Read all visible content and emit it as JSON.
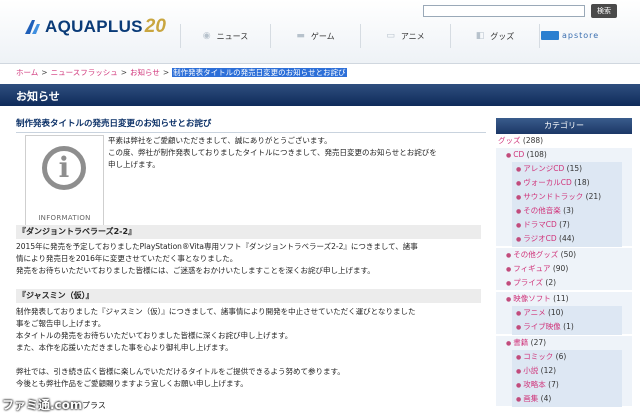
{
  "header": {
    "logo_text": "AQUAPLUS",
    "logo_badge": "20",
    "search_placeholder": "",
    "search_button": "検索",
    "nav": [
      {
        "label": "ニュース",
        "icon": "rss-icon"
      },
      {
        "label": "ゲーム",
        "icon": "gamepad-icon"
      },
      {
        "label": "アニメ",
        "icon": "tv-icon"
      },
      {
        "label": "グッズ",
        "icon": "bag-icon"
      }
    ],
    "apstore_label": "apstore"
  },
  "breadcrumb": {
    "items": [
      "ホーム",
      "ニュースフラッシュ",
      "お知らせ"
    ],
    "current": "制作発表タイトルの発売日変更のお知らせとお詫び"
  },
  "title_bar": "お知らせ",
  "article": {
    "title": "制作発表タイトルの発売日変更のお知らせとお詫び",
    "info_label": "INFORMATION",
    "intro": [
      "平素は弊社をご愛顧いただきまして、誠にありがとうございます。",
      "この度、弊社が制作発表しておりましたタイトルにつきまして、発売日変更のお知らせとお詫びを",
      "申し上げます。"
    ],
    "sections": [
      {
        "heading": "『ダンジョントラベラーズ2-2』",
        "lines": [
          "2015年に発売を予定しておりましたPlayStation®Vita専用ソフト『ダンジョントラベラーズ2-2』につきまして、諸事",
          "情により発売日を2016年に変更させていただく事となりました。",
          "発売をお待ちいただいておりました皆様には、ご迷惑をおかけいたしますことを深くお詫び申し上げます。"
        ]
      },
      {
        "heading": "『ジャスミン（仮）』",
        "lines": [
          "制作発表しておりました『ジャスミン（仮）』につきまして、諸事情により開発を中止させていただく運びとなりました",
          "事をご報告申し上げます。",
          "本タイトルの発売をお待ちいただいておりました皆様に深くお詫び申し上げます。",
          "また、本作を応援いただきました事を心より御礼申し上げます。"
        ]
      }
    ],
    "closing": [
      "弊社では、引き続き広く皆様に楽しんでいただけるタイトルをご提供できるよう努めて参ります。",
      "今後とも弊社作品をご愛顧賜りますよう宜しくお願い申し上げます。"
    ],
    "footer_text": "プラス"
  },
  "sidebar": {
    "heading": "カテゴリー",
    "groups": [
      {
        "label": "グッズ",
        "count": "(288)",
        "children": [
          {
            "label": "CD",
            "count": "(108)",
            "children": [
              {
                "label": "アレンジCD",
                "count": "(15)"
              },
              {
                "label": "ヴォーカルCD",
                "count": "(18)"
              },
              {
                "label": "サウンドトラック",
                "count": "(21)"
              },
              {
                "label": "その他音楽",
                "count": "(3)"
              },
              {
                "label": "ドラマCD",
                "count": "(7)"
              },
              {
                "label": "ラジオCD",
                "count": "(44)"
              }
            ]
          },
          {
            "label": "その他グッズ",
            "count": "(50)",
            "children": []
          },
          {
            "label": "フィギュア",
            "count": "(90)",
            "children": []
          },
          {
            "label": "プライズ",
            "count": "(2)",
            "children": []
          },
          {
            "label": "映像ソフト",
            "count": "(11)",
            "children": [
              {
                "label": "アニメ",
                "count": "(10)"
              },
              {
                "label": "ライブ映像",
                "count": "(1)"
              }
            ]
          },
          {
            "label": "書籍",
            "count": "(27)",
            "children": [
              {
                "label": "コミック",
                "count": "(6)"
              },
              {
                "label": "小説",
                "count": "(12)"
              },
              {
                "label": "攻略本",
                "count": "(7)"
              },
              {
                "label": "画集",
                "count": "(4)"
              }
            ]
          }
        ]
      }
    ]
  },
  "watermark": "ファミ通.com"
}
